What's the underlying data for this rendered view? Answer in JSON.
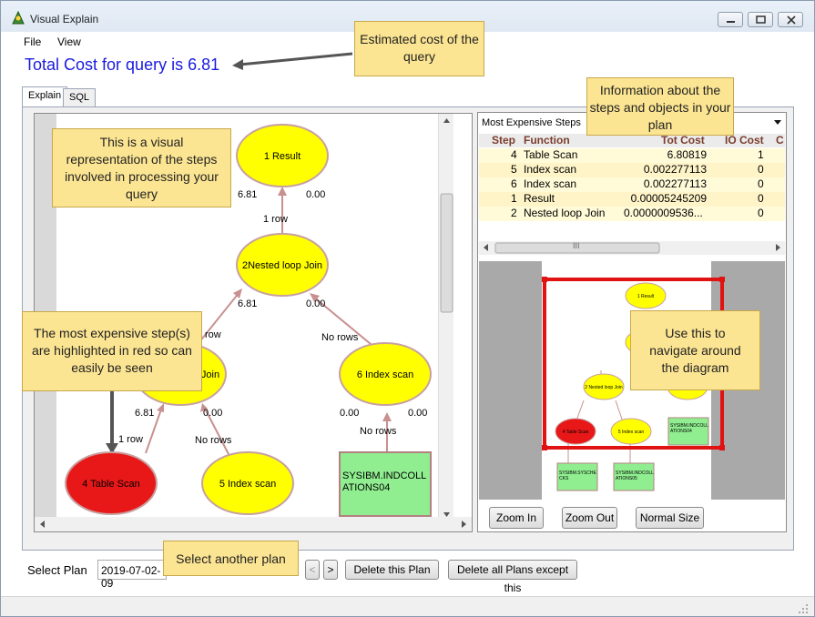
{
  "window": {
    "title": "Visual Explain"
  },
  "menu": {
    "file": "File",
    "view": "View"
  },
  "header": {
    "total_cost": "Total Cost for query is 6.81"
  },
  "tabs": [
    {
      "label": "Explain"
    },
    {
      "label": "SQL"
    }
  ],
  "diagram": {
    "nodes": {
      "result": "1 Result",
      "nlj": "2Nested loop Join",
      "join3": "Join",
      "index6": "6 Index scan",
      "table4": "4 Table Scan",
      "index5": "5 Index scan",
      "sysibm": "SYSIBM.INDCOLL ATIONS04"
    },
    "labels": {
      "result_left": "6.81",
      "result_right": "0.00",
      "nlj_left": "6.81",
      "nlj_right": "0.00",
      "join_left": "6.81",
      "join_right": "0.00",
      "idx6_left": "0.00",
      "idx6_right": "0.00",
      "row1": "1 row",
      "row2": "row",
      "row3": "1 row",
      "norows1": "No rows",
      "norows2": "No rows",
      "norows3": "No rows"
    }
  },
  "right_panel": {
    "dropdown_value": "Most Expensive Steps",
    "columns": [
      "Step",
      "Function",
      "Tot Cost",
      "IO Cost",
      "C"
    ],
    "rows": [
      {
        "step": "4",
        "function": "Table Scan",
        "tot_cost": "6.80819",
        "io_cost": "1"
      },
      {
        "step": "5",
        "function": "Index scan",
        "tot_cost": "0.002277113",
        "io_cost": "0"
      },
      {
        "step": "6",
        "function": "Index scan",
        "tot_cost": "0.002277113",
        "io_cost": "0"
      },
      {
        "step": "1",
        "function": "Result",
        "tot_cost": "0.00005245209",
        "io_cost": "0"
      },
      {
        "step": "2",
        "function": "Nested loop Join",
        "tot_cost": "0.0000009536...",
        "io_cost": "0"
      }
    ],
    "hscroll_grip": "III"
  },
  "navigator": {
    "result": "1 Result",
    "nlj": "2 Nested loop Join",
    "table4": "4 Table Scan",
    "index5": "5 Index scan",
    "box1": "SYSIBM.INDCOLL ATIONS04",
    "box2": "SYSIBM.SYSCHE CKS",
    "box3": "SYSIBM.INDCOLL ATIONS05"
  },
  "zoom": {
    "zoom_in": "Zoom In",
    "zoom_out": "Zoom Out",
    "normal": "Normal Size"
  },
  "footer": {
    "select_plan_label": "Select Plan",
    "plan_value": "2019-07-02-09",
    "prev": "<",
    "next": ">",
    "delete_plan": "Delete this Plan",
    "delete_all": "Delete all Plans except this"
  },
  "callouts": {
    "cost": "Estimated cost of the query",
    "info": "Information about the steps and objects in your plan",
    "visual": "This is a visual representation of the steps involved in processing your query",
    "expensive": "The most expensive step(s) are highlighted in red so can easily be seen",
    "navigate": "Use this to navigate around the diagram",
    "select": "Select another plan"
  },
  "colors": {
    "accent_text": "#1a1adf",
    "node_fill": "#ffff00",
    "expensive_fill": "#e81818",
    "table_fill": "#90ee90",
    "callout_fill": "#fce592"
  }
}
